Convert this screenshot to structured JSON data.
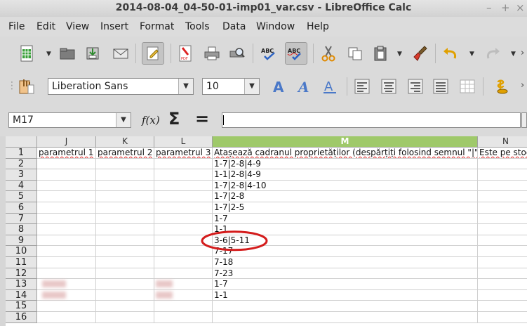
{
  "window": {
    "title": "2014-08-04_04-50-01-imp01_var.csv - LibreOffice Calc",
    "minimize_glyph": "–",
    "maximize_glyph": "+",
    "close_glyph": "×"
  },
  "menu": [
    "File",
    "Edit",
    "View",
    "Insert",
    "Format",
    "Tools",
    "Data",
    "Window",
    "Help"
  ],
  "formatting": {
    "font_name": "Liberation Sans",
    "font_size": "10"
  },
  "formula_bar": {
    "name_box": "M17",
    "function_wizard_label": "f(x)",
    "sum_glyph": "Σ",
    "equals_glyph": "=",
    "input_value": ""
  },
  "sheet": {
    "columns": [
      "J",
      "K",
      "L",
      "M",
      "N"
    ],
    "selected_column": "M",
    "rows": [
      {
        "n": "1",
        "J": "parametrul 1",
        "K": "parametrul 2",
        "L": "parametrul 3",
        "M": "Atașează cadranul proprietăților (despărțiți folosind semnul \"|\")",
        "N": "Este pe stoc"
      },
      {
        "n": "2",
        "J": "",
        "K": "",
        "L": "",
        "M": "1-7|2-8|4-9",
        "N": ""
      },
      {
        "n": "3",
        "J": "",
        "K": "",
        "L": "",
        "M": "1-1|2-8|4-9",
        "N": ""
      },
      {
        "n": "4",
        "J": "",
        "K": "",
        "L": "",
        "M": "1-7|2-8|4-10",
        "N": ""
      },
      {
        "n": "5",
        "J": "",
        "K": "",
        "L": "",
        "M": "1-7|2-8",
        "N": ""
      },
      {
        "n": "6",
        "J": "",
        "K": "",
        "L": "",
        "M": "1-7|2-5",
        "N": ""
      },
      {
        "n": "7",
        "J": "",
        "K": "",
        "L": "",
        "M": "1-7",
        "N": ""
      },
      {
        "n": "8",
        "J": "",
        "K": "",
        "L": "",
        "M": "1-1",
        "N": ""
      },
      {
        "n": "9",
        "J": "",
        "K": "",
        "L": "",
        "M": "3-6|5-11",
        "N": ""
      },
      {
        "n": "10",
        "J": "",
        "K": "",
        "L": "",
        "M": "7-17",
        "N": ""
      },
      {
        "n": "11",
        "J": "",
        "K": "",
        "L": "",
        "M": "7-18",
        "N": ""
      },
      {
        "n": "12",
        "J": "",
        "K": "",
        "L": "",
        "M": "7-23",
        "N": ""
      },
      {
        "n": "13",
        "J": "",
        "K": "",
        "L": "",
        "M": "1-7",
        "N": ""
      },
      {
        "n": "14",
        "J": "",
        "K": "",
        "L": "",
        "M": "1-1",
        "N": ""
      },
      {
        "n": "15",
        "J": "",
        "K": "",
        "L": "",
        "M": "",
        "N": ""
      },
      {
        "n": "16",
        "J": "",
        "K": "",
        "L": "",
        "M": "",
        "N": ""
      }
    ],
    "highlight_annotation": {
      "row": "9",
      "column": "M",
      "color": "#d41c1c"
    }
  },
  "colors": {
    "selected_column_header": "#9fc96a",
    "annotation_ellipse": "#d41c1c"
  }
}
